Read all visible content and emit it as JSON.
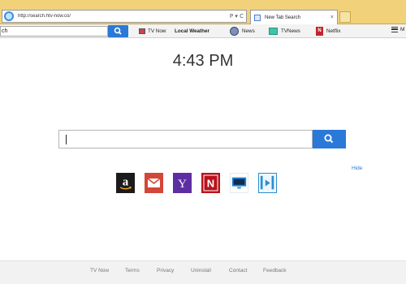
{
  "browser": {
    "address_url": "http://search.htv-now.co/",
    "address_controls": "P ▾ C",
    "tab_label": "New Tab Search",
    "tab_close": "×"
  },
  "toolbar": {
    "search_value": "ch",
    "items": [
      {
        "label": "TV Now",
        "icon": "tv-now-icon"
      },
      {
        "label": "Local Weather",
        "icon": ""
      },
      {
        "label": "News",
        "icon": "news-icon"
      },
      {
        "label": "TVNews",
        "icon": "tvnews-icon"
      },
      {
        "label": "Netflix",
        "icon": "netflix-icon"
      }
    ],
    "menu_label": "M"
  },
  "clock": {
    "time": "4:43 PM"
  },
  "main": {
    "search_value": "",
    "hide_label": "Hide",
    "tiles": [
      {
        "name": "amazon",
        "icon": "amazon-icon"
      },
      {
        "name": "gmail",
        "icon": "gmail-icon"
      },
      {
        "name": "yahoo",
        "icon": "yahoo-icon"
      },
      {
        "name": "netflix",
        "icon": "netflix-icon"
      },
      {
        "name": "tv",
        "icon": "tv-icon"
      },
      {
        "name": "video",
        "icon": "video-icon"
      }
    ]
  },
  "footer": {
    "links": [
      "TV Now",
      "Terms",
      "Privacy",
      "Uninstall",
      "Contact",
      "Feedback"
    ]
  },
  "colors": {
    "browser_chrome": "#f1d27a",
    "accent_blue": "#2a79d8"
  }
}
